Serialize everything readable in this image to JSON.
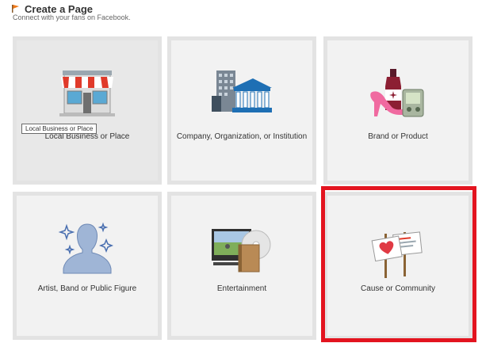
{
  "header": {
    "title": "Create a Page",
    "subtitle": "Connect with your fans on Facebook."
  },
  "tiles": [
    {
      "label": "Local Business or Place",
      "icon": "storefront-icon"
    },
    {
      "label": "Company, Organization, or Institution",
      "icon": "office-buildings-icon"
    },
    {
      "label": "Brand or Product",
      "icon": "products-icon"
    },
    {
      "label": "Artist, Band or Public Figure",
      "icon": "person-silhouette-icon"
    },
    {
      "label": "Entertainment",
      "icon": "media-icon"
    },
    {
      "label": "Cause or Community",
      "icon": "protest-signs-icon"
    }
  ],
  "tooltip": {
    "text": "Local Business or Place"
  },
  "colors": {
    "highlight": "#e3141f",
    "tile_background": "#f2f2f2",
    "tile_border": "#e3e3e3"
  }
}
